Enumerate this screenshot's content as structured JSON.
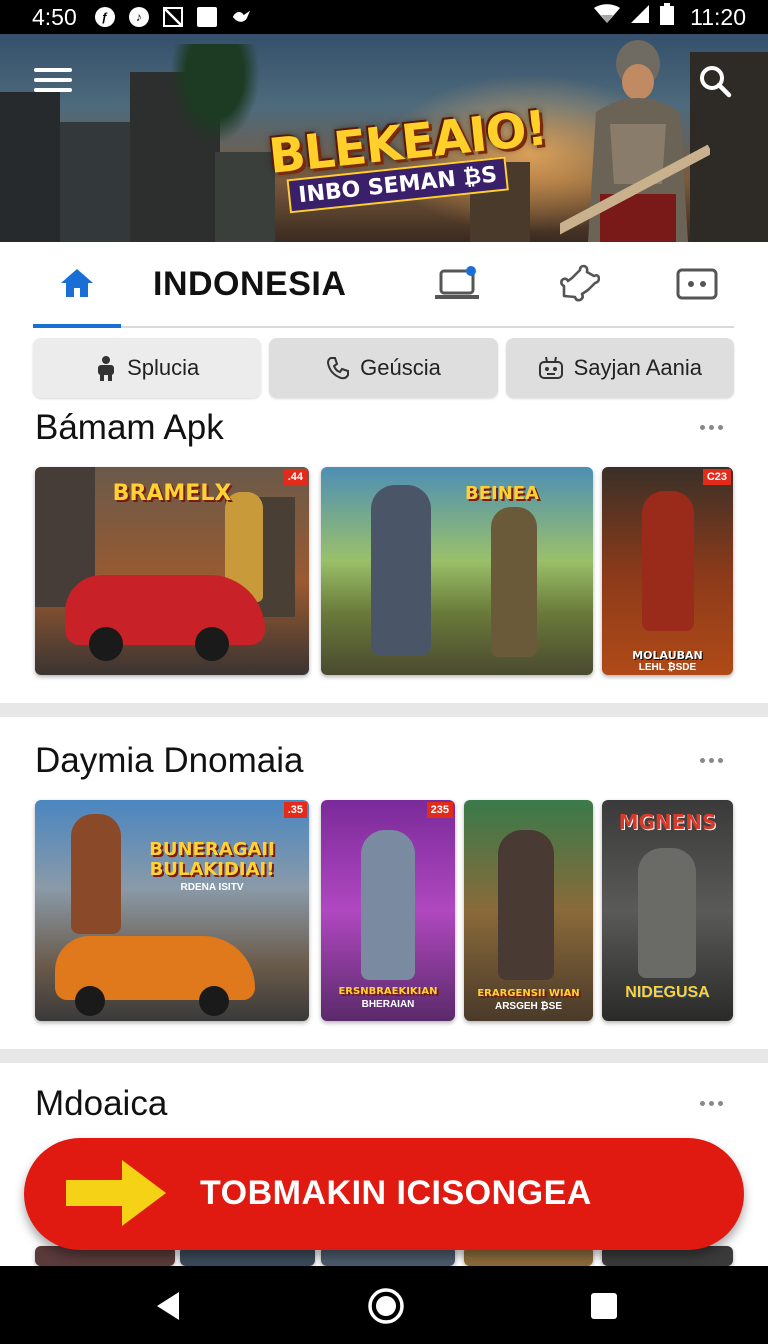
{
  "status_bar": {
    "time_left": "4:50",
    "time_right": "11:20"
  },
  "banner": {
    "title_line1": "BLEKEAIO!",
    "title_line2": "INBO SEMAN ₿S"
  },
  "tabs": {
    "title": "INDONESIA"
  },
  "chips": [
    {
      "label": "Splucia",
      "icon": "person-icon"
    },
    {
      "label": "Geúscia",
      "icon": "phone-icon"
    },
    {
      "label": "Sayjan Aania",
      "icon": "robot-icon"
    }
  ],
  "sections": [
    {
      "title": "Bámam Apk",
      "cards": [
        {
          "title": "BRAMELX",
          "subtitle": "",
          "badge": ".44"
        },
        {
          "title": "BEINEA",
          "subtitle": "",
          "badge": ""
        },
        {
          "title": "MOLAUBAN",
          "subtitle": "LEHL ₿SDE",
          "badge": "C23"
        }
      ]
    },
    {
      "title": "Daymia Dnomaia",
      "cards": [
        {
          "title": "BUNERAGAII BULAKIDIAI!",
          "subtitle": "RDENA ISITV",
          "badge": ".35"
        },
        {
          "title": "ERSNBRAEKIKIAN",
          "subtitle": "BHERAIAN",
          "badge": "235"
        },
        {
          "title": "ERARGENSII WIAN",
          "subtitle": "ARSGEH ₿SE",
          "badge": ""
        },
        {
          "title": "MGNENS",
          "subtitle": "NIDEGUSA",
          "badge": ""
        }
      ]
    },
    {
      "title": "Mdoaica"
    }
  ],
  "cta": {
    "label": "TOBMAKIN ICISONGEA"
  },
  "colors": {
    "accent": "#1a6fd6",
    "cta": "#e01a10",
    "arrow": "#f5d216"
  }
}
